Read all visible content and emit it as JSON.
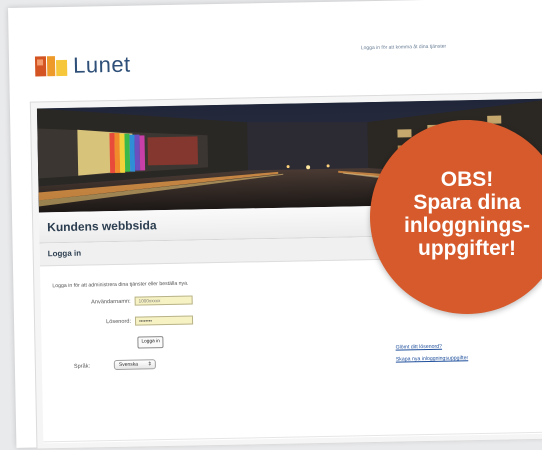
{
  "header": {
    "brand": "Lunet",
    "note": "Logga in för att komma åt dina tjänster"
  },
  "site": {
    "title": "Kundens webbsida"
  },
  "login": {
    "title": "Logga in",
    "intro": "Logga in för att administrera dina tjänster eller beställa nya.",
    "username_label": "Användarnamn:",
    "username_value": "1000xxxxx",
    "password_label": "Lösenord:",
    "password_value": "••••••••",
    "submit_label": "Logga in",
    "language_label": "Språk:",
    "language_selected": "Svenska",
    "forgot_link": "Glömt ditt lösenord?",
    "new_credentials_link": "Skapa nya inloggningsuppgifter"
  },
  "badge": {
    "line1": "OBS!",
    "line2": "Spara dina",
    "line3": "inloggnings-",
    "line4": "uppgifter!"
  },
  "colors": {
    "badge": "#d65a2b",
    "brand_text": "#2e4f78",
    "input_bg": "#f7f2c4",
    "link": "#1f4f9c"
  }
}
